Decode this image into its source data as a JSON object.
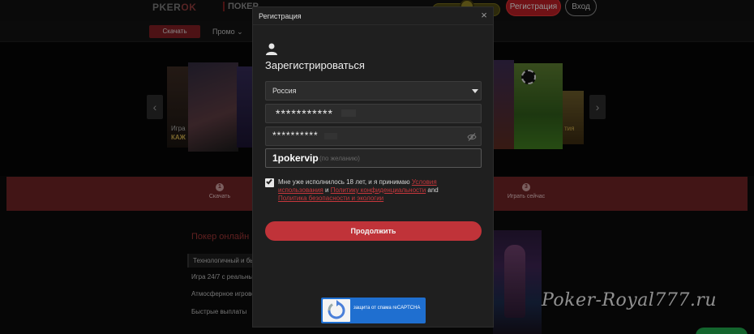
{
  "header": {
    "logo_text": "P",
    "logo_accent": "KER",
    "logo_ok": "OK",
    "nav_poker": "ПОКЕР",
    "register_label": "Регистрация",
    "login_label": "Вход"
  },
  "subnav": {
    "download_label": "Скачать",
    "promo_label": "Промо ⌄"
  },
  "banner": {
    "prev_label": "‹",
    "next_label": "›",
    "text_left_1": "Игра",
    "text_left_2": "КАЖ",
    "text_right": "тия"
  },
  "steps": [
    {
      "num": "1",
      "label": "Скачать"
    },
    {
      "num": "3",
      "label": "Играть сейчас"
    }
  ],
  "content": {
    "poker_online": "Покер онлайн",
    "features": [
      "Технологичный и бы",
      "Игра 24/7 с реальны",
      "Атмосферное игрово",
      "Быстрые выплаты"
    ],
    "watermark": "Poker-Royal777.ru"
  },
  "modal": {
    "title": "Регистрация",
    "close_label": "×",
    "heading": "Зарегистрироваться",
    "country_value": "Россия",
    "phone_mask": "***********",
    "password_mask": "**********",
    "promo_code": "1pokervip",
    "promo_placeholder": "(по желанию)",
    "terms_prefix": "Мне уже исполнилось 18 лет, и я принимаю ",
    "terms_link_1": "Условия использования",
    "terms_and_1": " и ",
    "terms_link_2": "Политику конфиденциальности",
    "terms_and_2": " and ",
    "terms_link_3": "Политика безопасности и экологии",
    "continue_label": "Продолжить",
    "recaptcha_text": "защита от спама reCAPTCHA"
  },
  "colors": {
    "accent": "#c03339",
    "link": "#c7373c",
    "step_band": "#6b2225",
    "recaptcha": "#1f6fd0"
  }
}
